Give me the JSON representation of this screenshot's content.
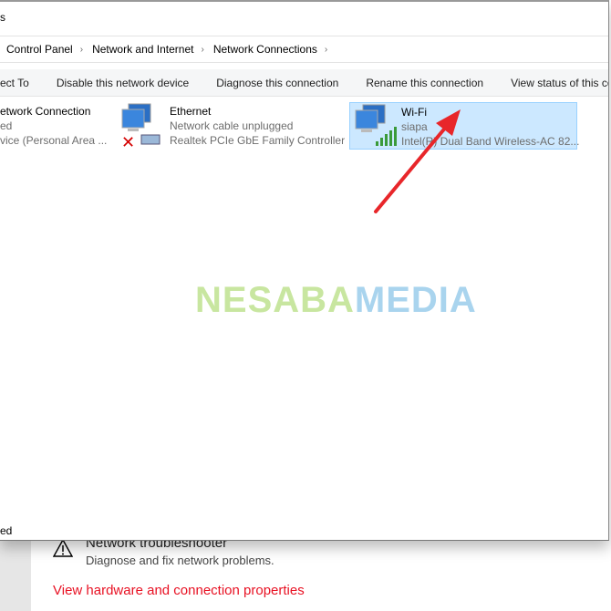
{
  "window": {
    "title_fragment": "s"
  },
  "breadcrumb": [
    "Control Panel",
    "Network and Internet",
    "Network Connections"
  ],
  "toolbar": [
    "ect To",
    "Disable this network device",
    "Diagnose this connection",
    "Rename this connection",
    "View status of this co"
  ],
  "connections": [
    {
      "name": "etwork Connection",
      "status": "ed",
      "device": "vice (Personal Area ..."
    },
    {
      "name": "Ethernet",
      "status": "Network cable unplugged",
      "device": "Realtek PCIe GbE Family Controller"
    },
    {
      "name": "Wi-Fi",
      "status": "siapa",
      "device": "Intel(R) Dual Band Wireless-AC 82...",
      "selected": true
    }
  ],
  "status_bar": "ed",
  "watermark": {
    "part1": "NESABA",
    "part2": "MEDIA",
    "color1": "#c8e6a0",
    "color2": "#a9d4ee"
  },
  "settings": {
    "troubleshooter_title": "Network troubleshooter",
    "troubleshooter_desc": "Diagnose and fix network problems.",
    "hardware_link": "View hardware and connection properties",
    "link_color": "#e81123"
  },
  "annotation": {
    "arrow_color": "#e8262a"
  }
}
